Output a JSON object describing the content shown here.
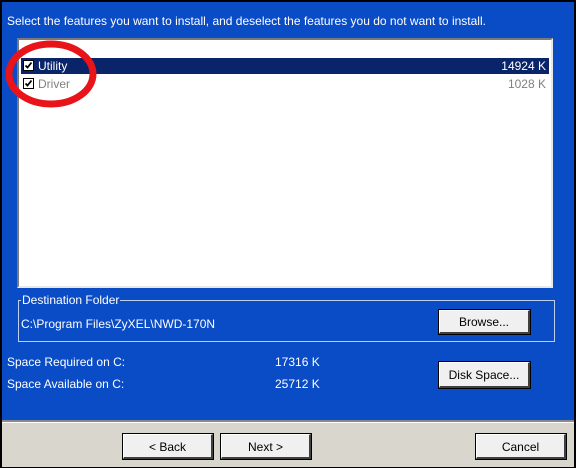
{
  "instructions": "Select the features you want to install, and deselect the features you do not want to install.",
  "features": [
    {
      "name": "Utility",
      "size": "14924 K",
      "checked": true,
      "selected": true
    },
    {
      "name": "Driver",
      "size": "1028 K",
      "checked": true,
      "selected": false
    }
  ],
  "destination": {
    "legend": "Destination Folder",
    "path": "C:\\Program Files\\ZyXEL\\NWD-170N",
    "browse_label": "Browse..."
  },
  "space": {
    "required_label": "Space Required on C:",
    "required_value": "17316 K",
    "available_label": "Space Available on C:",
    "available_value": "25712 K",
    "disk_space_label": "Disk Space..."
  },
  "nav": {
    "back_label": "< Back",
    "next_label": "Next >",
    "cancel_label": "Cancel"
  },
  "annotation": {
    "circle_color": "#e8141a"
  },
  "colors": {
    "background": "#0a4bc6",
    "selection": "#0a246a",
    "button_face": "#f0f0f0"
  }
}
